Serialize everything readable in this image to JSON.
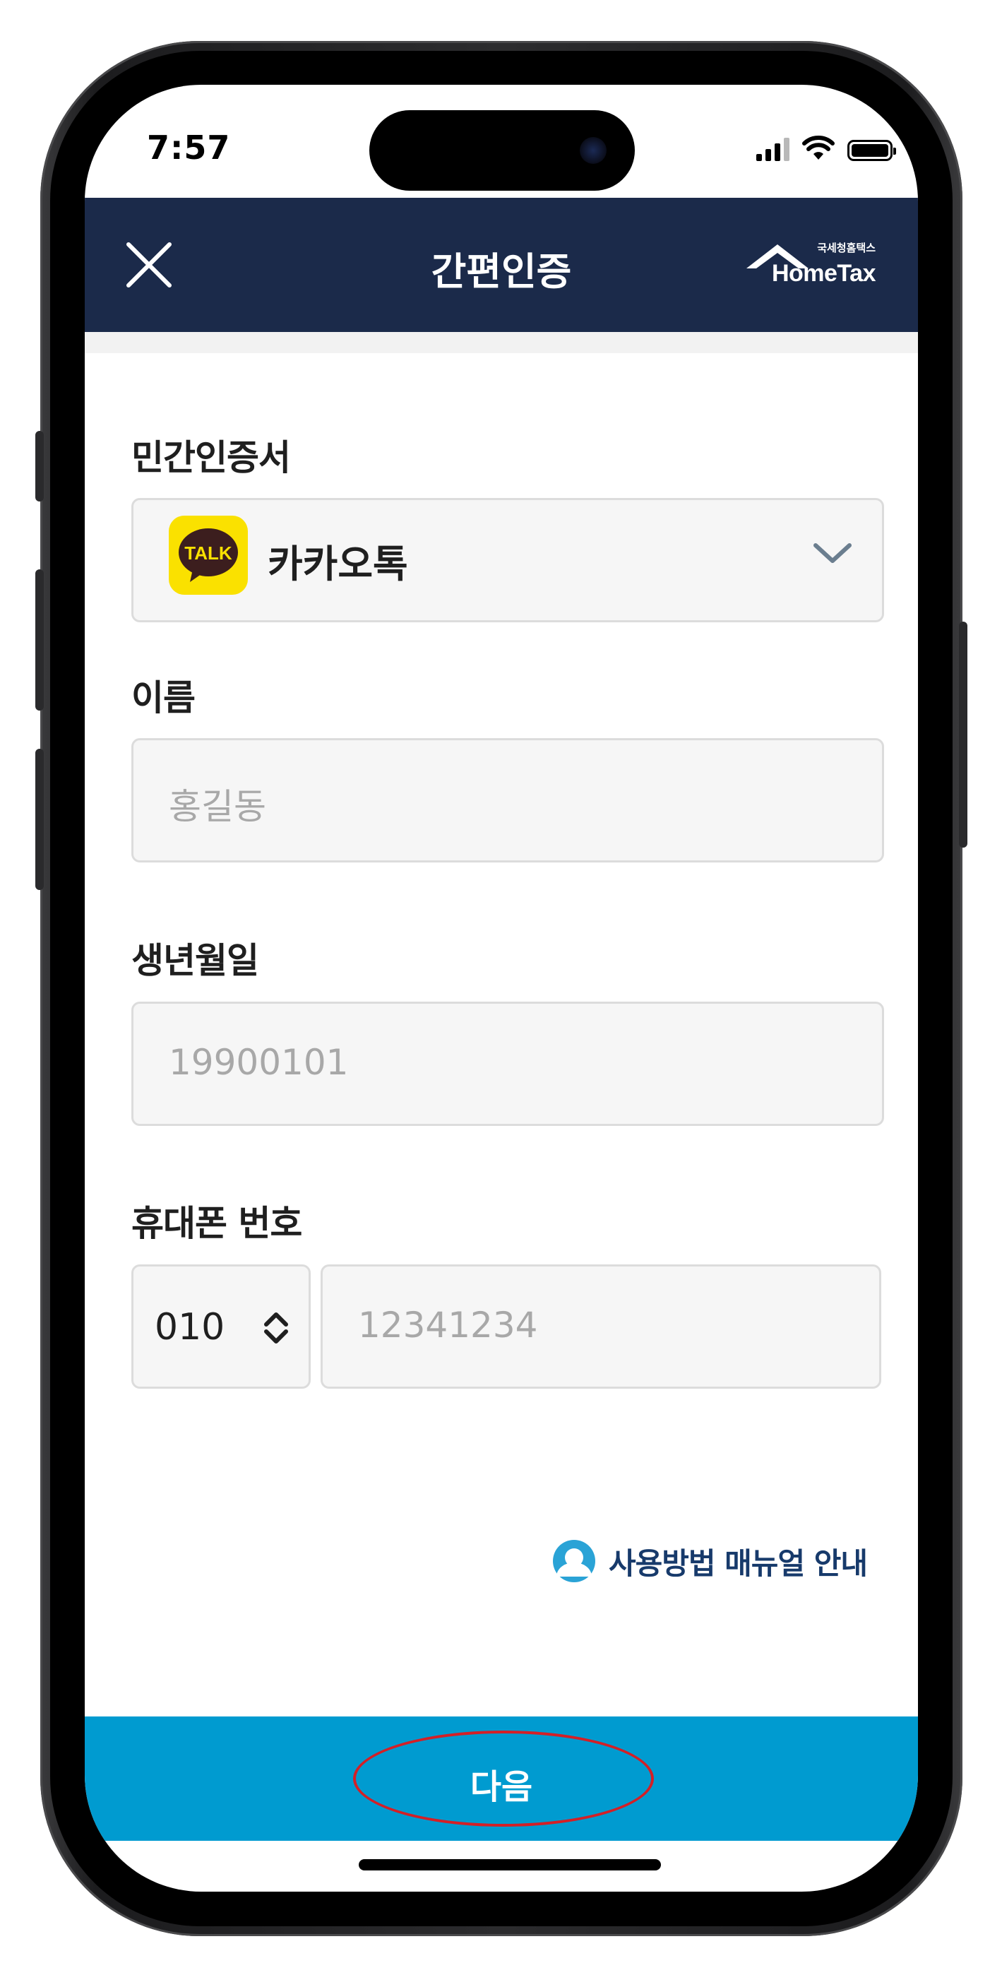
{
  "status_bar": {
    "time": "7:57"
  },
  "header": {
    "title": "간편인증",
    "logo_small": "국세청홈택스",
    "logo_main": "HomeTax"
  },
  "form": {
    "provider": {
      "label": "민간인증서",
      "selected": "카카오톡",
      "icon_text": "TALK"
    },
    "name": {
      "label": "이름",
      "placeholder": "홍길동"
    },
    "birth": {
      "label": "생년월일",
      "placeholder": "19900101"
    },
    "phone": {
      "label": "휴대폰 번호",
      "prefix": "010",
      "placeholder": "12341234"
    }
  },
  "manual_link": "사용방법 매뉴얼 안내",
  "next_button": "다음",
  "colors": {
    "header_bg": "#1b2a4a",
    "next_button_bg": "#009bd0",
    "kakao_yellow": "#fae100",
    "highlight": "#d41f26"
  }
}
